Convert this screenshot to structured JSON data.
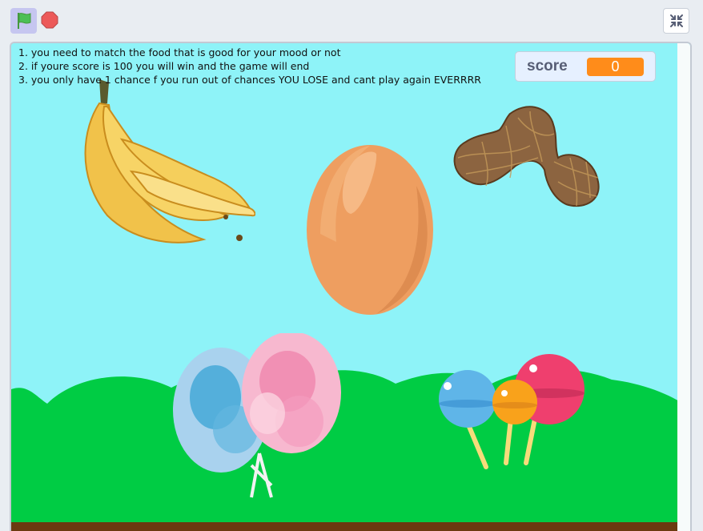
{
  "toolbar": {
    "green_flag_icon": "green-flag-icon",
    "stop_icon": "stop-sign-icon",
    "fullscreen_icon": "exit-fullscreen-icon"
  },
  "stage": {
    "instructions": [
      "1. you need to match the food that is good for your mood or not",
      "2. if youre score is 100 you will win and the game will end",
      "3. you only have 1 chance f you run out of chances YOU LOSE and cant play again EVERRRR"
    ],
    "score_monitor": {
      "label": "score",
      "value": "0"
    },
    "sprites": [
      "banana",
      "egg",
      "peanut",
      "cotton-candy",
      "lollipops"
    ]
  },
  "colors": {
    "sky": "#8ef3f8",
    "hills": "#00cc44",
    "ground": "#6b3a10",
    "score_badge": "#ff8c1a",
    "flag": "#4cbf56",
    "stop": "#ec5959"
  }
}
